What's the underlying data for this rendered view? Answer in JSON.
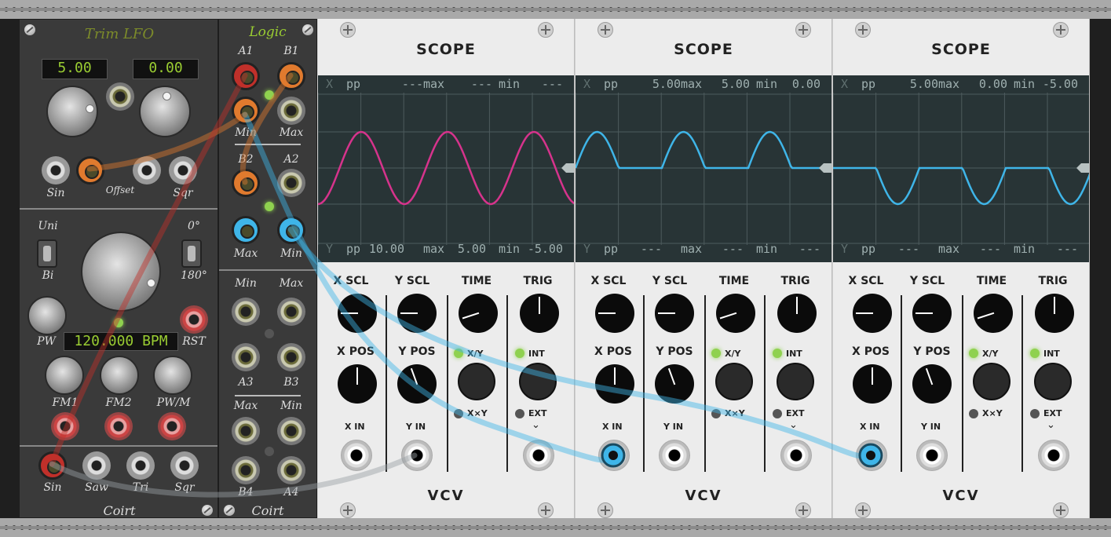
{
  "lfo": {
    "title": "Trim LFO",
    "display_left": "5.00",
    "display_right": "0.00",
    "outputs_top": [
      "Sin",
      "Offset",
      "Sqr"
    ],
    "switch_top": "Uni",
    "switch_bottom": "Bi",
    "phase_top": "0°",
    "phase_bottom": "180°",
    "pw_label": "PW",
    "bpm_display": "120.000 BPM",
    "rst_label": "RST",
    "mod_labels": [
      "FM1",
      "FM2",
      "PW/M"
    ],
    "outputs_bottom": [
      "Sin",
      "Saw",
      "Tri",
      "Sqr"
    ],
    "brand": "Coirt"
  },
  "logic": {
    "title": "Logic",
    "row1": [
      "A1",
      "B1"
    ],
    "row2": [
      "Min",
      "Max"
    ],
    "row3": [
      "B2",
      "A2"
    ],
    "row4": [
      "Max",
      "Min"
    ],
    "row5": [
      "Min",
      "Max"
    ],
    "row6": [
      "A3",
      "B3"
    ],
    "row7": [
      "Max",
      "Min"
    ],
    "row8": [
      "B4",
      "A4"
    ],
    "brand": "Coirt"
  },
  "scopes": [
    {
      "title": "SCOPE",
      "x_readout": {
        "pp": "---",
        "max": "---",
        "min": "---"
      },
      "y_readout": {
        "pp": "10.00",
        "max": "5.00",
        "min": "-5.00"
      },
      "trace_color": "#d6338c",
      "wave": "sine"
    },
    {
      "title": "SCOPE",
      "x_readout": {
        "pp": "5.00",
        "max": "5.00",
        "min": "0.00"
      },
      "y_readout": {
        "pp": "---",
        "max": "---",
        "min": "---"
      },
      "trace_color": "#3fb5e8",
      "wave": "half-positive"
    },
    {
      "title": "SCOPE",
      "x_readout": {
        "pp": "5.00",
        "max": "0.00",
        "min": "-5.00"
      },
      "y_readout": {
        "pp": "---",
        "max": "---",
        "min": "---"
      },
      "trace_color": "#3fb5e8",
      "wave": "half-negative"
    }
  ],
  "scope_labels": {
    "x_axis": "X",
    "y_axis": "Y",
    "pp": "pp",
    "max": "max",
    "min": "min",
    "x_scl": "X SCL",
    "y_scl": "Y SCL",
    "time": "TIME",
    "trig": "TRIG",
    "x_pos": "X POS",
    "y_pos": "Y POS",
    "xy": "X/Y",
    "xxy": "X×Y",
    "int": "INT",
    "ext": "EXT",
    "x_in": "X IN",
    "y_in": "Y IN",
    "brand": "VCV"
  },
  "colors": {
    "cable_blue": "#3fb5e8",
    "cable_orange": "#e07a2e",
    "cable_red": "#c0302a",
    "led_green": "#8fd14f"
  }
}
